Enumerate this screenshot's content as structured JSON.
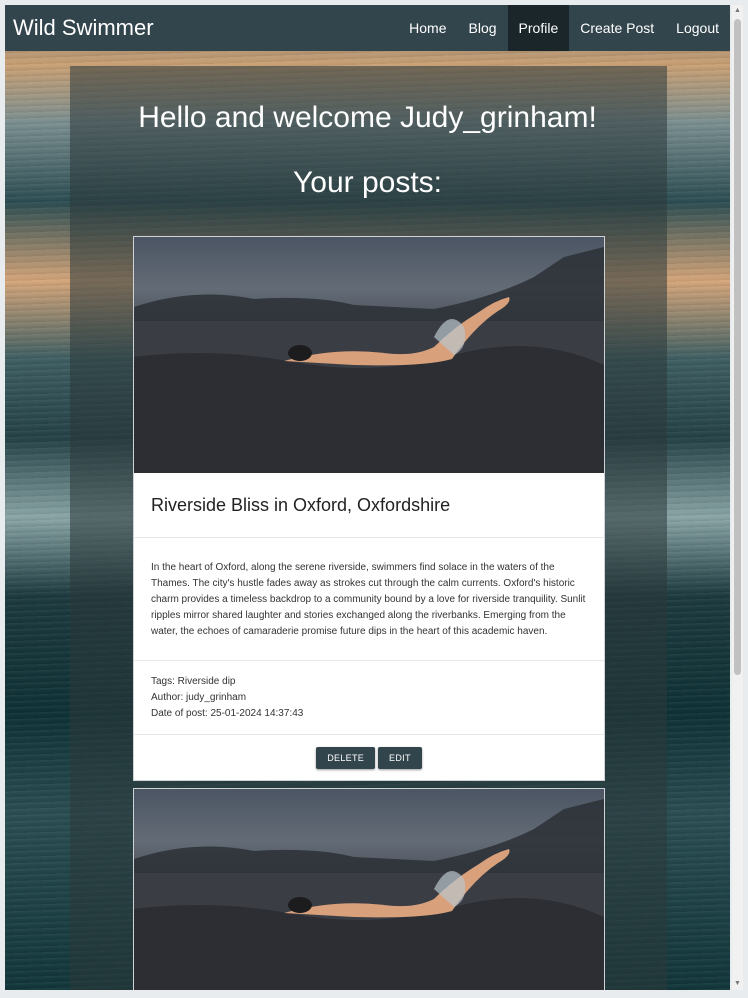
{
  "navbar": {
    "brand": "Wild Swimmer",
    "items": [
      {
        "label": "Home",
        "active": false
      },
      {
        "label": "Blog",
        "active": false
      },
      {
        "label": "Profile",
        "active": true
      },
      {
        "label": "Create Post",
        "active": false
      },
      {
        "label": "Logout",
        "active": false
      }
    ]
  },
  "profile": {
    "welcome": "Hello and welcome Judy_grinham!",
    "posts_heading": "Your posts:"
  },
  "posts": [
    {
      "title": "Riverside Bliss in Oxford, Oxfordshire",
      "body": "In the heart of Oxford, along the serene riverside, swimmers find solace in the waters of the Thames. The city's hustle fades away as strokes cut through the calm currents. Oxford's historic charm provides a timeless backdrop to a community bound by a love for riverside tranquility. Sunlit ripples mirror shared laughter and stories exchanged along the riverbanks. Emerging from the water, the echoes of camaraderie promise future dips in the heart of this academic haven.",
      "tags": "Tags: Riverside dip",
      "author": "Author: judy_grinham",
      "date": "Date of post: 25-01-2024 14:37:43",
      "delete_label": "DELETE",
      "edit_label": "EDIT"
    }
  ],
  "colors": {
    "navbar": "#33454c",
    "nav_active": "#1b262b",
    "button": "#33454c"
  }
}
